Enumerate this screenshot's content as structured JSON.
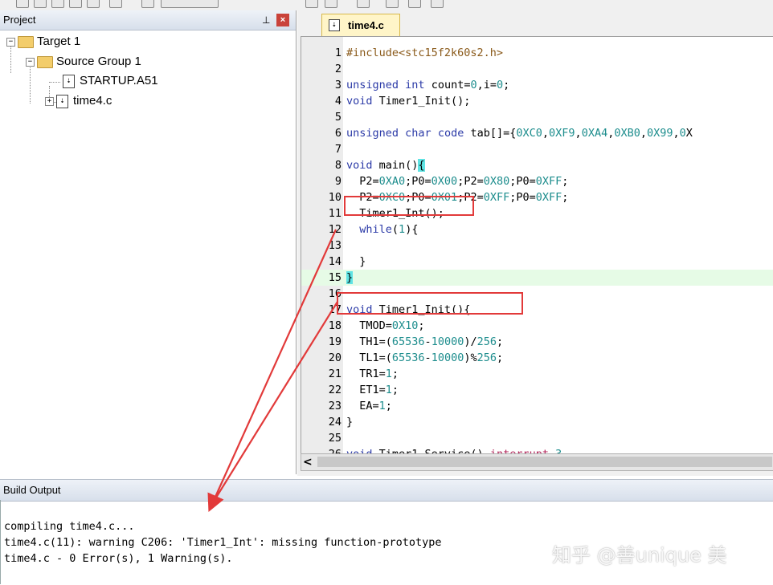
{
  "project_panel": {
    "title": "Project",
    "pin": "ᵖ",
    "close": "×",
    "tree": [
      {
        "label": "Target 1",
        "expander": "−"
      },
      {
        "label": "Source Group 1",
        "expander": "−"
      },
      {
        "label": "STARTUP.A51"
      },
      {
        "label": "time4.c",
        "expander": "+"
      }
    ]
  },
  "editor": {
    "tab_label": "time4.c",
    "scroll_left": "<",
    "lines": [
      {
        "n": "1",
        "code": "#include<stc15f2k60s2.h>"
      },
      {
        "n": "2",
        "code": ""
      },
      {
        "n": "3",
        "code": "unsigned int count=0,i=0;"
      },
      {
        "n": "4",
        "code": "void Timer1_Init();"
      },
      {
        "n": "5",
        "code": ""
      },
      {
        "n": "6",
        "code": "unsigned char code tab[]={0XC0,0XF9,0XA4,0XB0,0X99,0X"
      },
      {
        "n": "7",
        "code": ""
      },
      {
        "n": "8",
        "code": "void main(){"
      },
      {
        "n": "9",
        "code": "  P2=0XA0;P0=0X00;P2=0X80;P0=0XFF;"
      },
      {
        "n": "10",
        "code": "  P2=0XC0;P0=0X01;P2=0XFF;P0=0XFF;"
      },
      {
        "n": "11",
        "code": "  Timer1_Int();"
      },
      {
        "n": "12",
        "code": "  while(1){"
      },
      {
        "n": "13",
        "code": ""
      },
      {
        "n": "14",
        "code": "  }"
      },
      {
        "n": "15",
        "code": "}"
      },
      {
        "n": "16",
        "code": ""
      },
      {
        "n": "17",
        "code": "void Timer1_Init(){"
      },
      {
        "n": "18",
        "code": "  TMOD=0X10;"
      },
      {
        "n": "19",
        "code": "  TH1=(65536-10000)/256;"
      },
      {
        "n": "20",
        "code": "  TL1=(65536-10000)%256;"
      },
      {
        "n": "21",
        "code": "  TR1=1;"
      },
      {
        "n": "22",
        "code": "  ET1=1;"
      },
      {
        "n": "23",
        "code": "  EA=1;"
      },
      {
        "n": "24",
        "code": "}"
      },
      {
        "n": "25",
        "code": ""
      },
      {
        "n": "26",
        "code": "void Timer1_Service() interrupt 3"
      }
    ]
  },
  "build_output": {
    "title": "Build Output",
    "lines": [
      "compiling time4.c...",
      "time4.c(11): warning C206: 'Timer1_Int': missing function-prototype",
      "time4.c - 0 Error(s), 1 Warning(s)."
    ]
  },
  "watermark": "知乎 @善unique 美",
  "colors": {
    "annotation": "#e23a3a",
    "keyword": "#2b3aa7",
    "number": "#1d8d8d"
  }
}
